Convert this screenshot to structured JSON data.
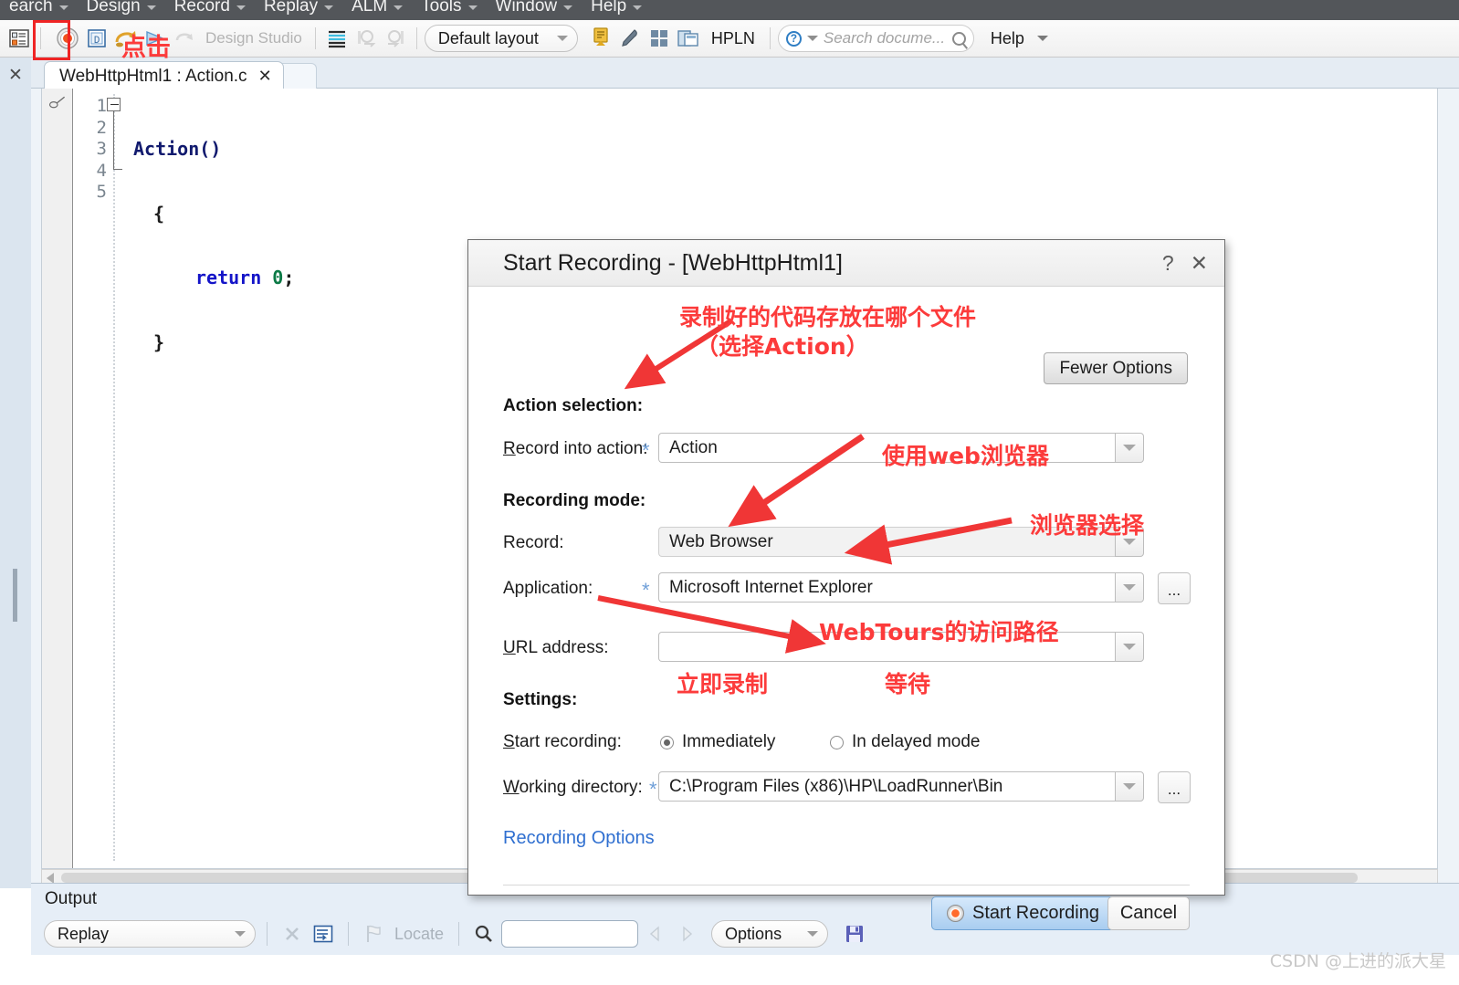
{
  "menubar": {
    "items": [
      {
        "label": "earch"
      },
      {
        "label": "Design"
      },
      {
        "label": "Record"
      },
      {
        "label": "Replay"
      },
      {
        "label": "ALM"
      },
      {
        "label": "Tools"
      },
      {
        "label": "Window"
      },
      {
        "label": "Help"
      }
    ]
  },
  "toolbar": {
    "design_studio_label": "Design Studio",
    "layout_label": "Default layout",
    "hpln_label": "HPLN",
    "search_placeholder": "Search docume...",
    "help_label": "Help",
    "icons": {
      "solution_explorer": "solution-explorer-icon",
      "record": "record-icon",
      "compile": "compile-icon",
      "replay": "replay-icon",
      "run_step": "run-step-icon",
      "design_studio": "design-studio-icon",
      "snapshot": "snapshot-icon",
      "runtime_settings": "runtime-settings-icon",
      "runtime_a": "runtime-viewer-a-icon",
      "runtime_b": "runtime-viewer-b-icon",
      "download": "download-icon",
      "brush": "brush-icon",
      "grid": "grid-icon",
      "window_layout": "window-layout-icon"
    }
  },
  "annotations": {
    "click_toolbar": "点击",
    "action_file": "录制好的代码存放在哪个文件",
    "action_file2": "（选择Action）",
    "use_web_browser": "使用web浏览器",
    "browser_select": "浏览器选择",
    "webtours_path": "WebTours的访问路径",
    "record_now": "立即录制",
    "wait_mode": "等待"
  },
  "editor": {
    "tab_title": "WebHttpHtml1 : Action.c",
    "tab_close": "✕",
    "line_numbers": [
      "1",
      "2",
      "3",
      "4",
      "5"
    ],
    "code": {
      "line1_fn": "Action()",
      "line2": "{",
      "line3_kw": "return",
      "line3_num": "0",
      "line3_semi": ";",
      "line4": "}"
    }
  },
  "dialog": {
    "title": "Start Recording - [WebHttpHtml1]",
    "help_glyph": "?",
    "close_glyph": "✕",
    "fewer_options_label": "Fewer Options",
    "sections": {
      "action_selection": "Action selection:",
      "recording_mode": "Recording mode:",
      "settings": "Settings:"
    },
    "fields": {
      "record_into_action": {
        "label_underline": "R",
        "label_rest": "ecord into action:",
        "required": "*",
        "value": "Action"
      },
      "record": {
        "label": "Record:",
        "value": "Web Browser"
      },
      "application": {
        "label": "Application:",
        "required": "*",
        "value": "Microsoft Internet Explorer",
        "browse": "..."
      },
      "url_address": {
        "label_underline": "U",
        "label_rest": "RL address:",
        "value": ""
      },
      "start_recording": {
        "label_underline": "S",
        "label_rest": "tart recording:",
        "options": [
          {
            "label": "Immediately",
            "selected": true
          },
          {
            "label": "In delayed mode",
            "selected": false
          }
        ]
      },
      "working_directory": {
        "label_underline": "W",
        "label_rest": "orking directory:",
        "required": "*",
        "value": "C:\\Program Files (x86)\\HP\\LoadRunner\\Bin",
        "browse": "..."
      }
    },
    "recording_options_link": "Recording Options",
    "buttons": {
      "start_recording": "Start Recording",
      "cancel": "Cancel"
    }
  },
  "output": {
    "title": "Output",
    "filter_value": "Replay",
    "locate_label": "Locate",
    "options_label": "Options",
    "search_value": "",
    "icons": {
      "clear": "clear-icon",
      "wrap": "word-wrap-icon",
      "locate": "locate-flag-icon",
      "find": "find-magnifier-icon",
      "prev": "prev-arrow-icon",
      "next": "next-arrow-icon",
      "save": "save-disk-icon"
    }
  },
  "watermark": "CSDN @上进的派大星",
  "colors": {
    "menubar_bg": "#53565a",
    "annotation_red": "#fc3b3b",
    "link_blue": "#2f6fd0",
    "required_blue": "#6f9fd8",
    "panel_blue": "#e6eef7"
  }
}
